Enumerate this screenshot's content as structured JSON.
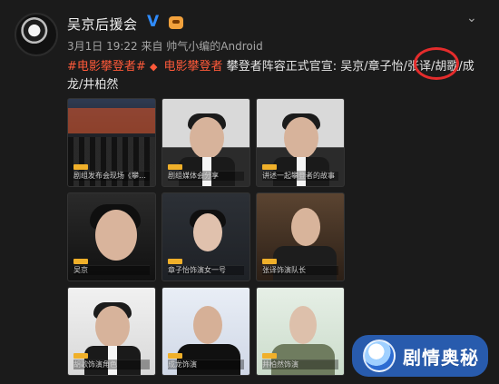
{
  "post": {
    "author": "吴京后援会",
    "time_source": "3月1日 19:22 来自 帅气小编的Android",
    "hashtag": "#电影攀登者#",
    "topic": "电影攀登者",
    "text": "攀登者阵容正式官宣: 吴京/章子怡/张译/胡歌/成龙/井柏然"
  },
  "grid": {
    "captions": [
      "剧组发布会现场《攀登者》",
      "剧组媒体会分享",
      "讲述一起攀登者的故事",
      "吴京",
      "章子怡饰演女一号",
      "张译饰演队长",
      "胡歌饰演角色",
      "成龙饰演",
      "井柏然饰演"
    ]
  },
  "watermark": {
    "text": "剧情奥秘"
  }
}
